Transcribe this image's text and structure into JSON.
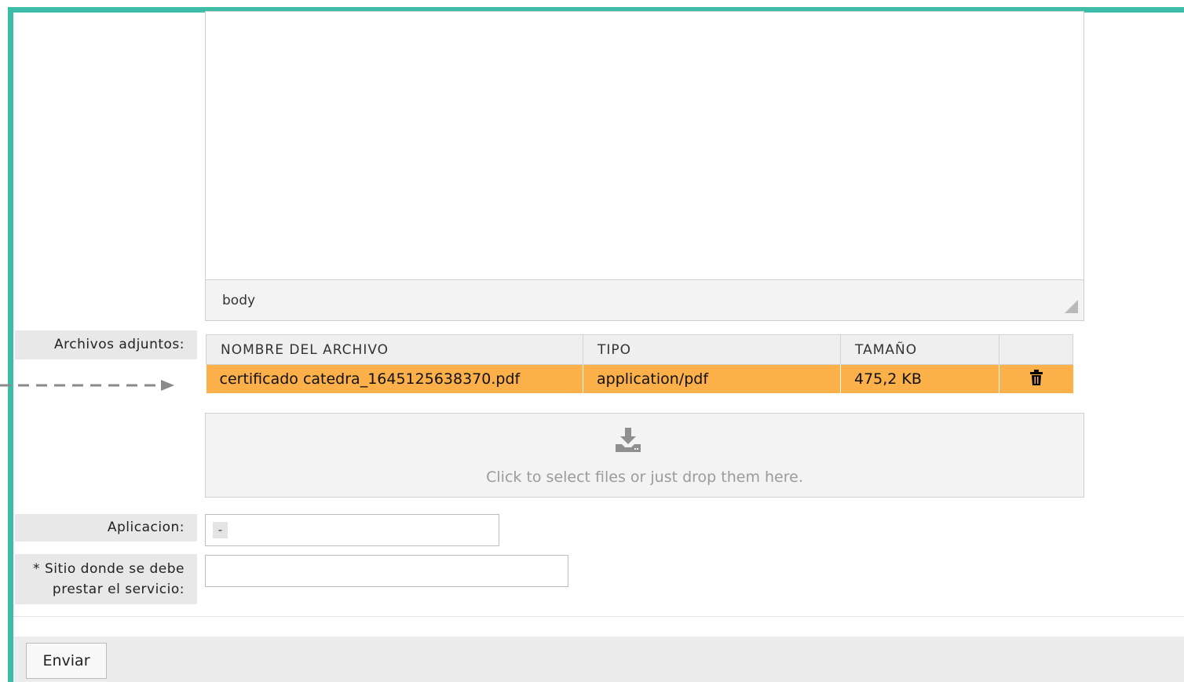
{
  "editor": {
    "status_path": "body"
  },
  "attachments": {
    "label": "Archivos adjuntos:",
    "columns": [
      "NOMBRE DEL ARCHIVO",
      "TIPO",
      "TAMAÑO",
      ""
    ],
    "rows": [
      {
        "name": "certificado catedra_1645125638370.pdf",
        "type": "application/pdf",
        "size": "475,2 KB"
      }
    ],
    "row_color": "#fbb04a"
  },
  "dropzone": {
    "icon": "download-icon",
    "text": "Click to select files or just drop them here."
  },
  "aplicacion": {
    "label": "Aplicacion:",
    "value": "-"
  },
  "sitio": {
    "label_line1": "* Sitio donde se debe",
    "label_line2": "prestar el servicio:",
    "value": ""
  },
  "submit": {
    "label": "Enviar"
  },
  "colors": {
    "frame": "#3dbda8"
  }
}
